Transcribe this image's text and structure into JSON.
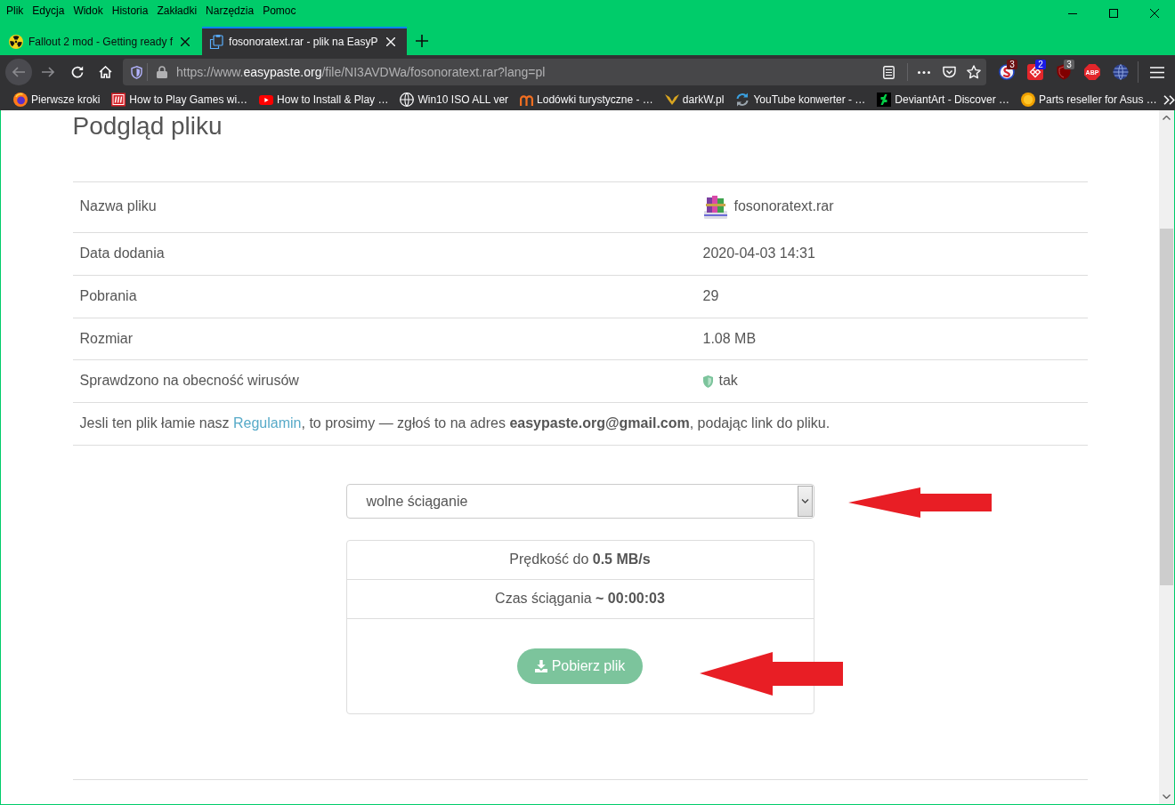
{
  "menu_bar": {
    "items": [
      "Plik",
      "Edycja",
      "Widok",
      "Historia",
      "Zakładki",
      "Narzędzia",
      "Pomoc"
    ]
  },
  "tabs": [
    {
      "title": "Fallout 2 mod - Getting ready f",
      "selected": false
    },
    {
      "title": "fosonoratext.rar - plik na EasyP",
      "selected": true
    }
  ],
  "nav_bar": {
    "back_disabled": true,
    "forward_disabled": true,
    "url": {
      "before_domain": "https://www.",
      "domain": "easypaste.org",
      "after_domain": "/file/NI3AVDWa/fosonoratext.rar?lang=pl"
    },
    "extensions": [
      {
        "kind": "counter",
        "badge": "3",
        "color": "#6b1012"
      },
      {
        "kind": "counter",
        "badge": "2",
        "color": "#1a1ae6"
      },
      {
        "kind": "counter",
        "badge": "3",
        "color": "#5f5f61"
      },
      {
        "kind": "label",
        "label": "ABP"
      },
      {
        "kind": "plain"
      }
    ]
  },
  "bookmarks": [
    "Pierwsze kroki",
    "How to Play Games wi…",
    "How to Install & Play …",
    "Win10 ISO ALL ver",
    "Lodówki turystyczne - …",
    "darkW.pl",
    "YouTube konwerter - …",
    "DeviantArt - Discover …",
    "Parts reseller for Asus …"
  ],
  "page": {
    "title": "Podgląd pliku",
    "details": [
      {
        "kind": "file",
        "label": "Nazwa pliku",
        "value": "fosonoratext.rar"
      },
      {
        "kind": "text",
        "label": "Data dodania",
        "value": "2020-04-03 14:31"
      },
      {
        "kind": "text",
        "label": "Pobrania",
        "value": "29"
      },
      {
        "kind": "text",
        "label": "Rozmiar",
        "value": "1.08 MB"
      },
      {
        "kind": "verified",
        "label": "Sprawdzono na obecność wirusów",
        "value": "tak"
      }
    ],
    "notice": {
      "before": "Jesli ten plik łamie nasz ",
      "link": "Regulamin",
      "after": ", to prosimy — zgłoś to na adres **easypaste.org@gmail.com**, podając link do pliku."
    },
    "download_mode": {
      "value": "wolne ściąganie"
    },
    "download_info": [
      "Prędkość do **0.5 MB/s**",
      "Czas ściągania **~ 00:00:03**"
    ],
    "download_button": "Pobierz plik"
  }
}
